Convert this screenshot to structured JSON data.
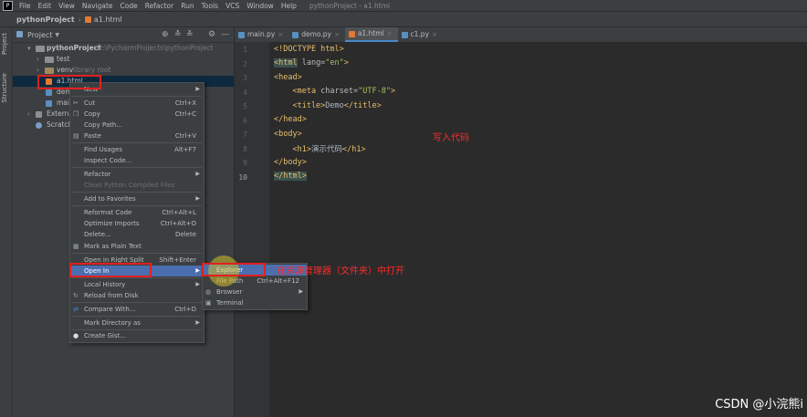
{
  "menubar": {
    "items": [
      "File",
      "Edit",
      "View",
      "Navigate",
      "Code",
      "Refactor",
      "Run",
      "Tools",
      "VCS",
      "Window",
      "Help"
    ],
    "window_title": "pythonProject - a1.html"
  },
  "navbar": {
    "project": "pythonProject",
    "file": "a1.html"
  },
  "stripe": {
    "project_tab": "Project",
    "structure_tab": "Structure"
  },
  "project_panel": {
    "title": "Project",
    "root_name": "pythonProject",
    "root_path": "D:\\PycharmProjects\\pythonProject",
    "rows": [
      "test",
      "venv",
      "library root",
      "a1.html",
      "demo",
      "main",
      "External",
      "Scratch"
    ]
  },
  "editor": {
    "tabs": [
      "main.py",
      "demo.py",
      "a1.html",
      "c1.py"
    ],
    "active_tab": "a1.html",
    "line_numbers": [
      "1",
      "2",
      "3",
      "4",
      "5",
      "6",
      "7",
      "8",
      "9",
      "10"
    ],
    "lines": {
      "l1": "<!DOCTYPE html>",
      "l2_tag": "<html",
      "l2_attr": " lang=",
      "l2_str": "\"en\"",
      "l2_end": ">",
      "l3": "<head>",
      "l4_tag": "    <meta",
      "l4_attr": " charset=",
      "l4_str": "\"UTF-8\"",
      "l4_end": ">",
      "l5_open": "    <title>",
      "l5_txt": "Demo",
      "l5_close": "</title>",
      "l6": "</head>",
      "l7": "<body>",
      "l8_open": "    <h1>",
      "l8_txt": "演示代码",
      "l8_close": "</h1>",
      "l9": "</body>",
      "l10": "</html>"
    }
  },
  "context_menu": {
    "new": "New",
    "cut": "Cut",
    "cut_sc": "Ctrl+X",
    "copy": "Copy",
    "copy_sc": "Ctrl+C",
    "copy_path": "Copy Path...",
    "paste": "Paste",
    "paste_sc": "Ctrl+V",
    "find_usages": "Find Usages",
    "find_usages_sc": "Alt+F7",
    "inspect_code": "Inspect Code...",
    "refactor": "Refactor",
    "clean_python": "Clean Python Compiled Files",
    "add_favorites": "Add to Favorites",
    "reformat": "Reformat Code",
    "reformat_sc": "Ctrl+Alt+L",
    "optimize": "Optimize Imports",
    "optimize_sc": "Ctrl+Alt+O",
    "delete": "Delete...",
    "delete_sc": "Delete",
    "mark_plain": "Mark as Plain Text",
    "open_right": "Open in Right Split",
    "open_right_sc": "Shift+Enter",
    "open_in": "Open In",
    "local_history": "Local History",
    "reload": "Reload from Disk",
    "compare": "Compare With...",
    "compare_sc": "Ctrl+D",
    "mark_dir": "Mark Directory as",
    "create_gist": "Create Gist..."
  },
  "submenu": {
    "explorer": "Explorer",
    "file_path": "File Path",
    "file_path_sc": "Ctrl+Alt+F12",
    "browser": "Browser",
    "terminal": "Terminal"
  },
  "annotations": {
    "write_code": "写入代码",
    "open_in_explorer": "在资源管理器（文件夹）中打开"
  },
  "watermark": "CSDN @小浣熊i",
  "colors": {
    "selection": "#4b6eaf",
    "annotation_red": "#e02020",
    "tag": "#e8bf6a",
    "string": "#a5c25c"
  }
}
